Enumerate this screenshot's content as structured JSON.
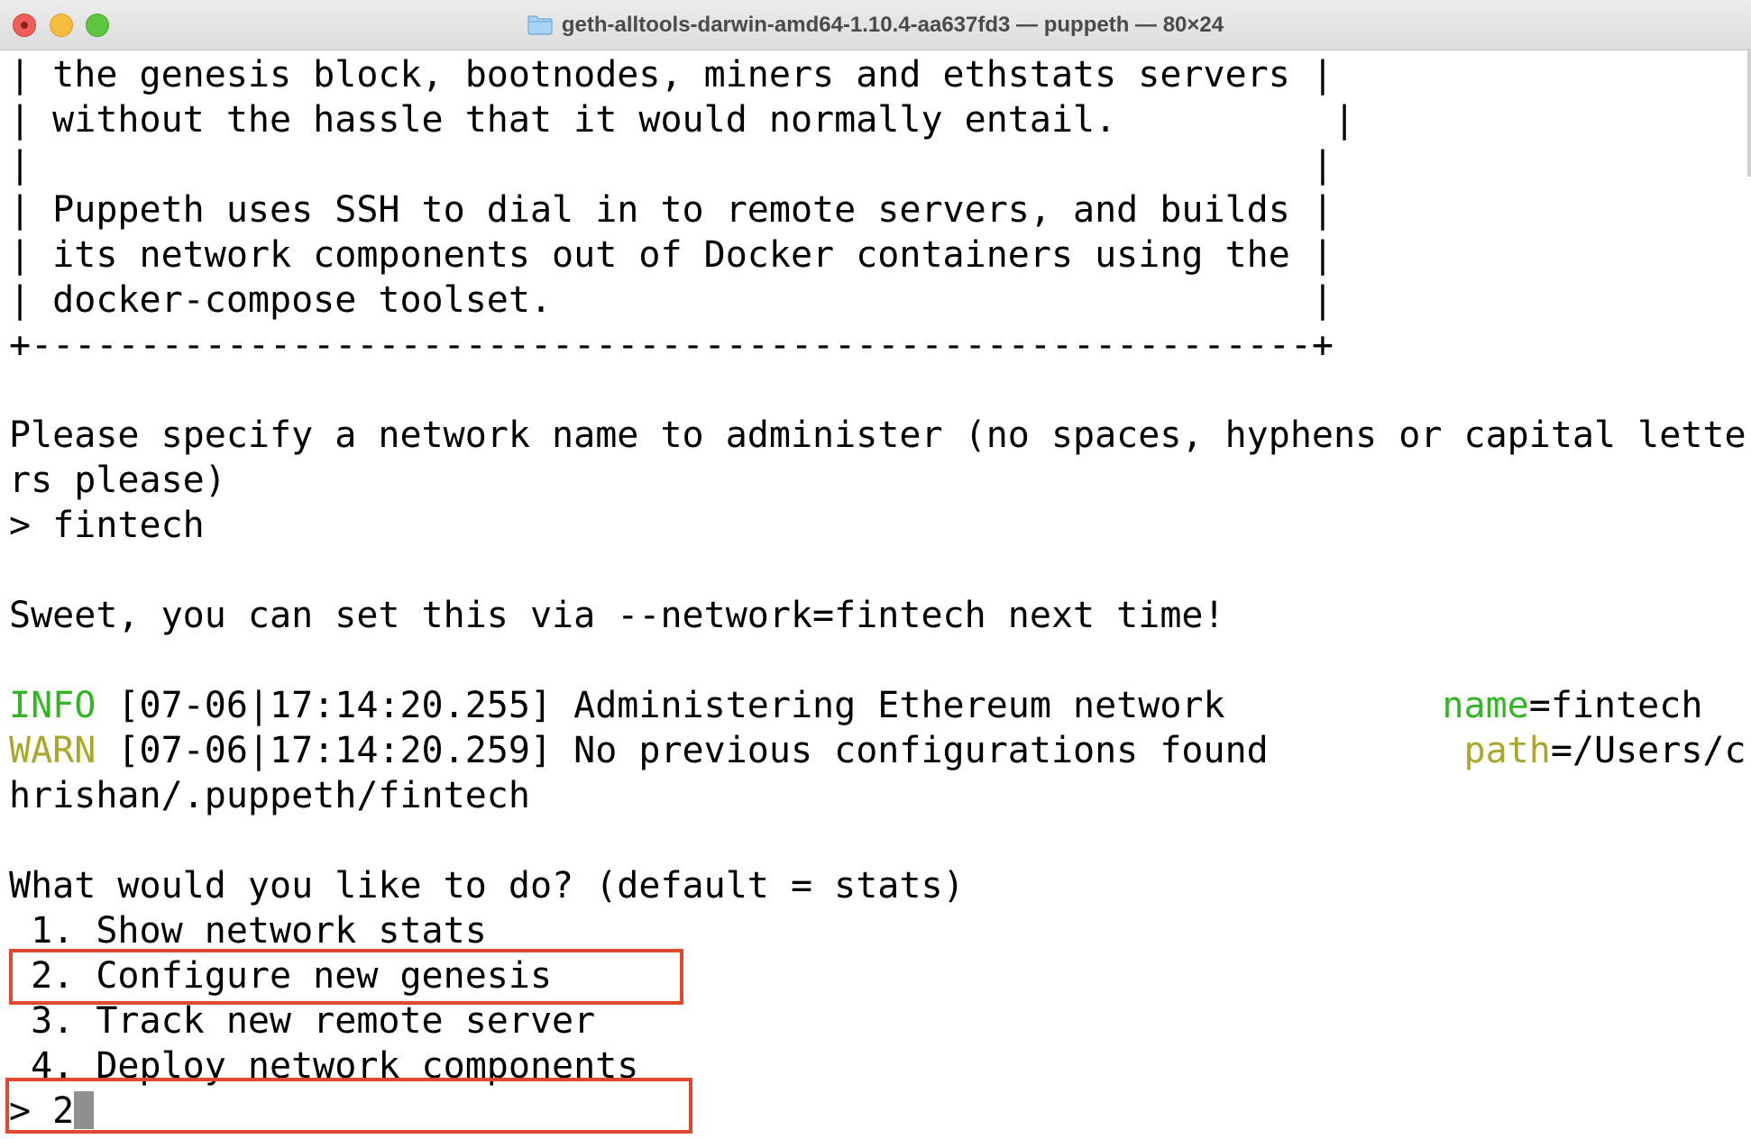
{
  "window": {
    "title": "geth-alltools-darwin-amd64-1.10.4-aa637fd3 — puppeth — 80×24",
    "folder_icon": "folder-icon"
  },
  "terminal": {
    "banner": [
      "| the genesis block, bootnodes, miners and ethstats servers |",
      "| without the hassle that it would normally entail.          |",
      "|                                                           |",
      "| Puppeth uses SSH to dial in to remote servers, and builds |",
      "| its network components out of Docker containers using the |",
      "| docker-compose toolset.                                   |",
      "+-----------------------------------------------------------+"
    ],
    "prompt_network_1": "Please specify a network name to administer (no spaces, hyphens or capital lette",
    "prompt_network_2": "rs please)",
    "input_network": "> fintech",
    "sweet": "Sweet, you can set this via --network=fintech next time!",
    "log1": {
      "level": "INFO",
      "rest": " [07-06|17:14:20.255] Administering Ethereum network          ",
      "key": "name",
      "value": "=fintech"
    },
    "log2": {
      "level": "WARN",
      "rest": " [07-06|17:14:20.259] No previous configurations found         ",
      "key": "path",
      "value": "=/Users/c"
    },
    "log2_cont": "hrishan/.puppeth/fintech",
    "question": "What would you like to do? (default = stats)",
    "options": [
      " 1. Show network stats",
      " 2. Configure new genesis",
      " 3. Track new remote server",
      " 4. Deploy network components"
    ],
    "input_choice": "> 2"
  },
  "colors": {
    "info": "#34b526",
    "warn": "#a9a82b",
    "highlight": "#e0482f"
  }
}
